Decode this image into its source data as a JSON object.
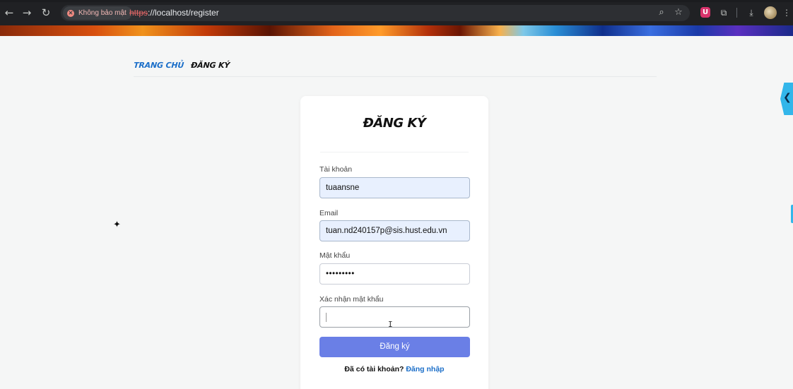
{
  "browser": {
    "security_chip": "Không bảo mật",
    "url_scheme": "https",
    "url_rest": "://localhost/register",
    "icons": [
      "back-icon",
      "forward-icon",
      "reload-icon",
      "zoom-icon",
      "bookmark-star-icon",
      "shield-extension-icon",
      "extensions-puzzle-icon",
      "download-icon",
      "profile-avatar",
      "menu-dots-icon"
    ]
  },
  "breadcrumb": {
    "home": "TRANG CHỦ",
    "current": "ĐĂNG KÝ"
  },
  "form": {
    "title": "ĐĂNG KÝ",
    "fields": [
      {
        "label": "Tài khoản",
        "value": "tuaansne"
      },
      {
        "label": "Email",
        "value": "tuan.nd240157p@sis.hust.edu.vn"
      },
      {
        "label": "Mật khẩu",
        "value": "•••••••••"
      },
      {
        "label": "Xác nhận mật khẩu",
        "value": ""
      }
    ],
    "submit_label": "Đăng ký",
    "login_prompt": "Đã có tài khoản?",
    "login_link": "Đăng nhập"
  },
  "colors": {
    "accent_button": "#6a7fe6",
    "link": "#1c6fc9",
    "side_tab": "#33b6ea"
  }
}
